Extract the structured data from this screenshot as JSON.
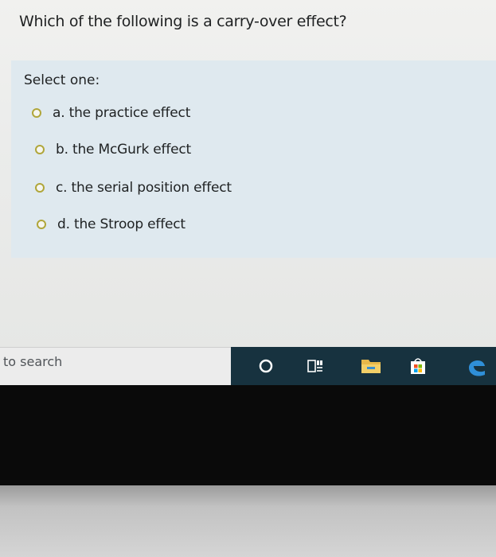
{
  "question": {
    "title": "Which of the following is a carry-over effect?"
  },
  "answers": {
    "prompt": "Select one:",
    "options": [
      {
        "label": "a. the practice effect"
      },
      {
        "label": "b. the McGurk effect"
      },
      {
        "label": "c. the serial position effect"
      },
      {
        "label": "d. the Stroop effect"
      }
    ]
  },
  "taskbar": {
    "search_placeholder": "to search",
    "icons": [
      "cortana-icon",
      "task-view-icon",
      "file-explorer-icon",
      "store-icon",
      "edge-icon"
    ]
  },
  "colors": {
    "taskbar": "#17323f",
    "panel": "#dfe9ef",
    "radio_border": "#b0a63a"
  }
}
